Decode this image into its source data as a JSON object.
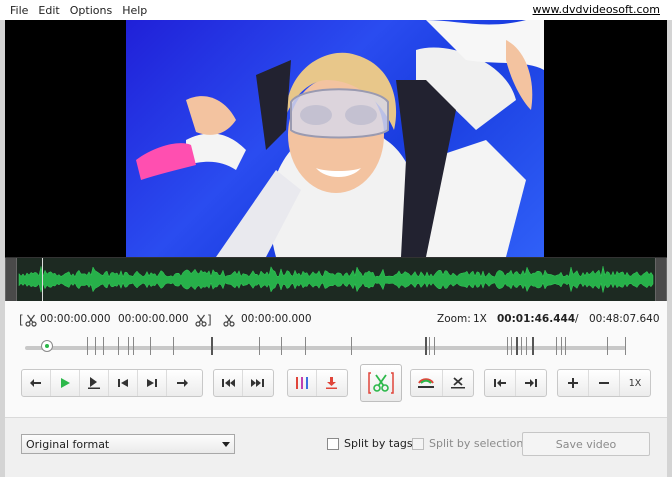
{
  "menu": {
    "items": [
      "File",
      "Edit",
      "Options",
      "Help"
    ],
    "site_link": "www.dvdvideosoft.com"
  },
  "times": {
    "start": "00:00:00.000",
    "end": "00:00:00.000",
    "cut": "00:00:00.000",
    "zoom_label": "Zoom:",
    "zoom_value": "1X",
    "current": "00:01:46.444",
    "separator": "/",
    "total": "00:48:07.640"
  },
  "timeline": {
    "position_fraction": 0.037
  },
  "buttons": {
    "zoom_reset_label": "1X"
  },
  "bottom": {
    "format_value": "Original format",
    "split_by_tags": "Split by tags",
    "split_by_selections": "Split by selections",
    "save_video": "Save video"
  },
  "colors": {
    "play_green": "#2cb84a",
    "cut_red": "#e0453a",
    "waveform_green": "#27b04a",
    "video_bg": "#000000"
  },
  "icons": [
    "scissors-icon",
    "play-icon",
    "step-back-icon",
    "step-forward-icon",
    "prev-frame-icon",
    "next-frame-icon",
    "jump-start-icon",
    "jump-end-icon",
    "split-markers-icon",
    "download-icon",
    "cut-icon",
    "fade-icon",
    "delete-icon",
    "goto-start-icon",
    "goto-end-icon",
    "zoom-in-icon",
    "zoom-out-icon"
  ]
}
